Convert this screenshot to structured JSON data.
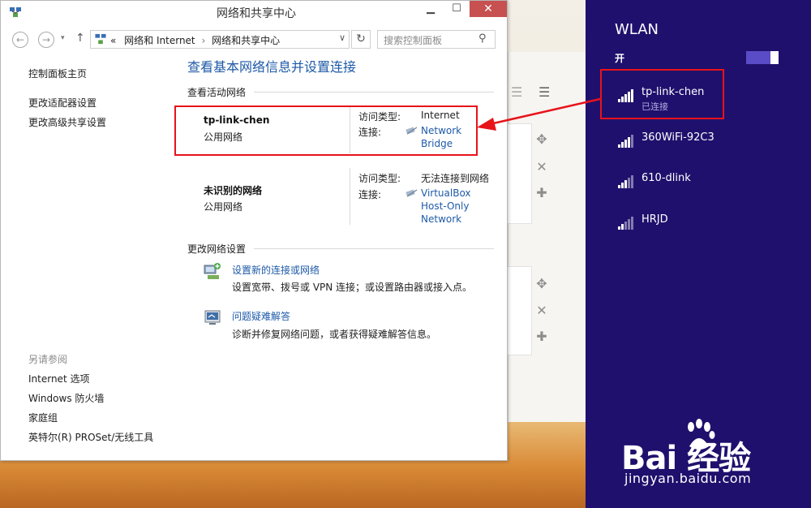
{
  "window": {
    "title": "网络和共享中心"
  },
  "address_bar": {
    "prefix": "«",
    "crumb1": "网络和 Internet",
    "crumb_sep": "›",
    "crumb2": "网络和共享中心"
  },
  "search": {
    "placeholder": "搜索控制面板"
  },
  "left_nav": {
    "home": "控制面板主页",
    "adapter": "更改适配器设置",
    "sharing": "更改高级共享设置",
    "see_also": "另请参阅",
    "internet_options": "Internet 选项",
    "firewall": "Windows 防火墙",
    "homegroup": "家庭组",
    "proset": "英特尔(R) PROSet/无线工具"
  },
  "main": {
    "title": "查看基本网络信息并设置连接",
    "active_networks": "查看活动网络",
    "networks": [
      {
        "name": "tp-link-chen",
        "type": "公用网络",
        "access_label": "访问类型:",
        "access_value": "Internet",
        "conn_label": "连接:",
        "conn_line1": "Network",
        "conn_line2": "Bridge"
      },
      {
        "name": "未识别的网络",
        "type": "公用网络",
        "access_label": "访问类型:",
        "access_value": "无法连接到网络",
        "conn_label": "连接:",
        "conn_line1": "VirtualBox",
        "conn_line2": "Host-Only",
        "conn_line3": "Network"
      }
    ],
    "change_settings": "更改网络设置",
    "tasks": [
      {
        "link": "设置新的连接或网络",
        "desc": "设置宽带、拨号或 VPN 连接；或设置路由器或接入点。"
      },
      {
        "link": "问题疑难解答",
        "desc": "诊断并修复网络问题，或者获得疑难解答信息。"
      }
    ]
  },
  "wlan": {
    "title": "WLAN",
    "switch_label": "开",
    "networks": [
      {
        "name": "tp-link-chen",
        "status": "已连接"
      },
      {
        "name": "360WiFi-92C3"
      },
      {
        "name": "610-dlink"
      },
      {
        "name": "HRJD"
      }
    ]
  },
  "watermark": {
    "brand": "Bai  经验",
    "url": "jingyan.baidu.com"
  },
  "colors": {
    "link": "#1e5aa8",
    "charm_bg": "#20106d",
    "highlight": "#e8131a"
  }
}
